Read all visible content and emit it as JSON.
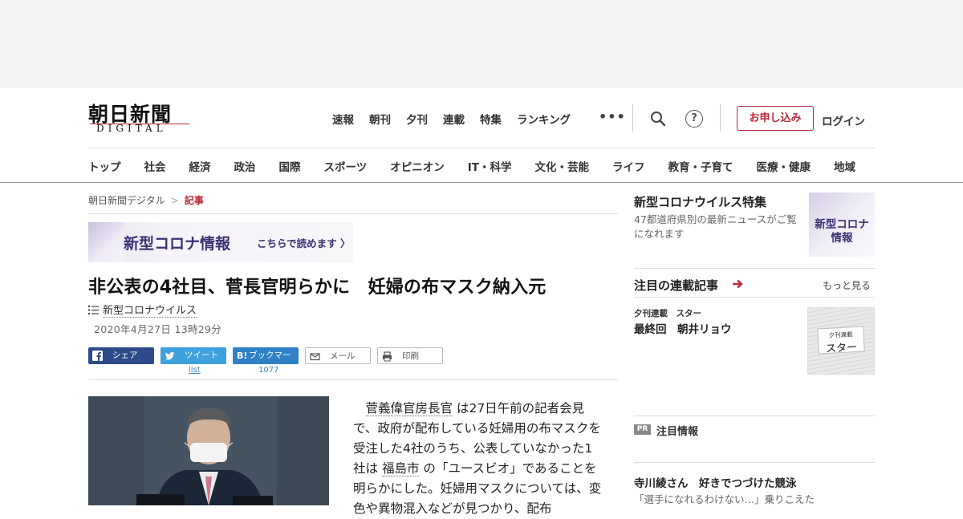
{
  "header": {
    "logo_kanji": "朝日新聞",
    "logo_sub": "DIGITAL",
    "nav": [
      "速報",
      "朝刊",
      "夕刊",
      "連載",
      "特集",
      "ランキング"
    ],
    "more": "•••",
    "help": "?",
    "apply_label": "お申し込み",
    "login_label": "ログイン"
  },
  "categories": [
    "トップ",
    "社会",
    "経済",
    "政治",
    "国際",
    "スポーツ",
    "オピニオン",
    "IT・科学",
    "文化・芸能",
    "ライフ",
    "教育・子育て",
    "医療・健康",
    "地域"
  ],
  "breadcrumb": {
    "home": "朝日新聞デジタル",
    "sep": ">",
    "current": "記事"
  },
  "banner": {
    "title": "新型コロナ情報",
    "sub": "こちらで読めます",
    "arrow": "〉"
  },
  "article": {
    "headline": "非公表の4社目、菅長官明らかに　妊婦の布マスク納入元",
    "topic": "新型コロナウイルス",
    "date": "2020年4月27日 13時29分",
    "body_parts": [
      "菅義偉官房長官",
      "は27日午前の記者会見で、政府が配布している妊婦用の布マスクを受注した4社のうち、公表していなかった1社は",
      "福島市",
      "の「ユースビオ」であることを明らかにした。妊婦用マスクについては、変色や異物混入などが見つかり、配布"
    ]
  },
  "share": {
    "facebook": "シェア",
    "twitter": "ツイート",
    "twitter_count": "list",
    "hatena_mark": "B!",
    "hatena": "ブックマーク",
    "hatena_count": "1077",
    "mail": "メール",
    "print": "印刷"
  },
  "sidebar": {
    "corona": {
      "title": "新型コロナウイルス特集",
      "desc": "47都道府県別の最新ニュースがご覧になれます",
      "thumb_line1": "新型コロナ",
      "thumb_line2": "情報"
    },
    "series": {
      "title": "注目の連載記事",
      "more": "もっと見る",
      "kicker": "夕刊連載　スター",
      "name": "最終回　朝井リョウ",
      "thumb_kicker": "夕刊連載",
      "thumb_title": "スター"
    },
    "pr": {
      "badge": "PR",
      "title": "注目情報",
      "headline": "寺川綾さん　好きでつづけた競泳",
      "desc": "「選手になれるわけない…」乗りこえた"
    }
  },
  "colors": {
    "brand_red": "#b9283a",
    "corona_purple": "#3a3272",
    "facebook": "#2d4a8a",
    "twitter": "#3ea0dd",
    "hatena": "#2f80c4"
  }
}
